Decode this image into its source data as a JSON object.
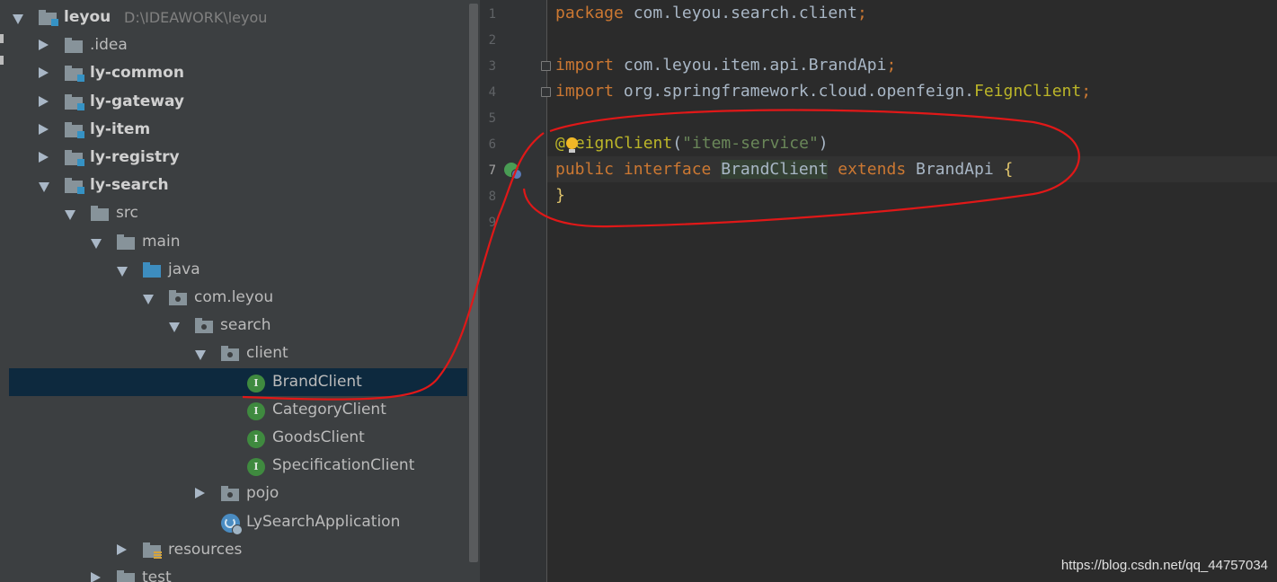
{
  "project_tree": {
    "root": {
      "name": "leyou",
      "path": "D:\\IDEAWORK\\leyou"
    },
    "items": [
      {
        "label": "leyou",
        "hint": "D:\\IDEAWORK\\leyou",
        "depth": 0,
        "state": "expanded",
        "icon": "folder-module-icon",
        "bold": true
      },
      {
        "label": ".idea",
        "depth": 1,
        "state": "collapsed",
        "icon": "folder-icon",
        "bold": false
      },
      {
        "label": "ly-common",
        "depth": 1,
        "state": "collapsed",
        "icon": "folder-module-icon",
        "bold": true
      },
      {
        "label": "ly-gateway",
        "depth": 1,
        "state": "collapsed",
        "icon": "folder-module-icon",
        "bold": true
      },
      {
        "label": "ly-item",
        "depth": 1,
        "state": "collapsed",
        "icon": "folder-module-icon",
        "bold": true
      },
      {
        "label": "ly-registry",
        "depth": 1,
        "state": "collapsed",
        "icon": "folder-module-icon",
        "bold": true
      },
      {
        "label": "ly-search",
        "depth": 1,
        "state": "expanded",
        "icon": "folder-module-icon",
        "bold": true
      },
      {
        "label": "src",
        "depth": 2,
        "state": "expanded",
        "icon": "folder-icon",
        "bold": false
      },
      {
        "label": "main",
        "depth": 3,
        "state": "expanded",
        "icon": "folder-icon",
        "bold": false
      },
      {
        "label": "java",
        "depth": 4,
        "state": "expanded",
        "icon": "source-folder-icon",
        "bold": false
      },
      {
        "label": "com.leyou",
        "depth": 5,
        "state": "expanded",
        "icon": "package-icon",
        "bold": false
      },
      {
        "label": "search",
        "depth": 6,
        "state": "expanded",
        "icon": "package-icon",
        "bold": false
      },
      {
        "label": "client",
        "depth": 7,
        "state": "expanded",
        "icon": "package-icon",
        "bold": false
      },
      {
        "label": "BrandClient",
        "depth": 8,
        "state": "leaf",
        "icon": "interface-icon",
        "bold": false,
        "selected": true
      },
      {
        "label": "CategoryClient",
        "depth": 8,
        "state": "leaf",
        "icon": "interface-icon",
        "bold": false
      },
      {
        "label": "GoodsClient",
        "depth": 8,
        "state": "leaf",
        "icon": "interface-icon",
        "bold": false
      },
      {
        "label": "SpecificationClient",
        "depth": 8,
        "state": "leaf",
        "icon": "interface-icon",
        "bold": false
      },
      {
        "label": "pojo",
        "depth": 7,
        "state": "collapsed",
        "icon": "package-icon",
        "bold": false
      },
      {
        "label": "LySearchApplication",
        "depth": 7,
        "state": "leaf",
        "icon": "spring-boot-app-icon",
        "bold": false
      },
      {
        "label": "resources",
        "depth": 4,
        "state": "collapsed",
        "icon": "resources-folder-icon",
        "bold": false
      },
      {
        "label": "test",
        "depth": 3,
        "state": "collapsed",
        "icon": "folder-icon",
        "bold": false
      }
    ]
  },
  "editor": {
    "line_numbers": [
      "1",
      "2",
      "3",
      "4",
      "5",
      "6",
      "7",
      "8",
      "9"
    ],
    "current_line": "7",
    "code": {
      "l1_kw": "package",
      "l1_rest": " com.leyou.search.client",
      "l1_semi": ";",
      "l3_kw": "import",
      "l3_rest": " com.leyou.item.api.BrandApi",
      "l3_semi": ";",
      "l4_kw": "import",
      "l4_rest": " org.springframework.cloud.openfeign.",
      "l4_cls": "FeignClient",
      "l4_semi": ";",
      "l6_at": "@",
      "l6_name": "eignClient",
      "l6_open": "(",
      "l6_str": "\"item-service\"",
      "l6_close": ")",
      "l7_kw1": "public interface",
      "l7_sp1": " ",
      "l7_name": "BrandClient",
      "l7_sp2": " ",
      "l7_kw2": "extends",
      "l7_rest": " BrandApi ",
      "l7_brace": "{",
      "l8_brace": "}"
    }
  },
  "icons": {
    "intention": "lightbulb-icon",
    "gutter": "implemented-interface-icon"
  },
  "watermark": "https://blog.csdn.net/qq_44757034",
  "colors": {
    "panel_bg": "#3c3f41",
    "editor_bg": "#2b2b2b",
    "selection": "#0d293e",
    "keyword": "#cc7832",
    "annotation": "#bbb529",
    "string": "#6a8759",
    "red_annotation": "#e01818"
  }
}
